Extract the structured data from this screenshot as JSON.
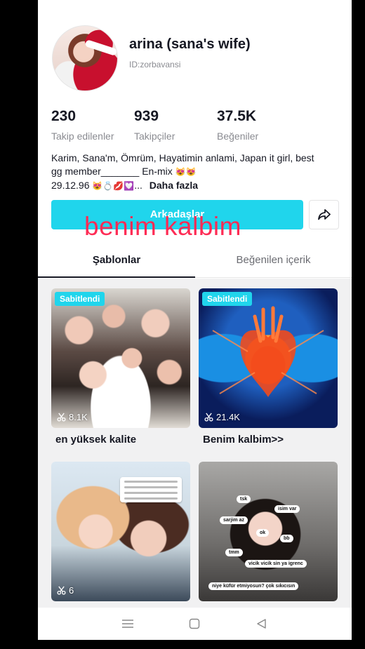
{
  "profile": {
    "username": "arina (sana's wife)",
    "id": "ID:zorbavansi",
    "stats": [
      {
        "value": "230",
        "label": "Takip edilenler"
      },
      {
        "value": "939",
        "label": "Takipçiler"
      },
      {
        "value": "37.5K",
        "label": "Beğeniler"
      }
    ],
    "bio_line1": "Karim, Sana'm, Ömrüm, Hayatimin anlami, Japan it girl, best",
    "bio_line2": "gg member_______ En-mix",
    "bio_line3": "29.12.96",
    "bio_more": "Daha fazla"
  },
  "actions": {
    "friends_label": "Arkadaşlar",
    "overlay_text": "benim kalbim"
  },
  "tabs": [
    {
      "label": "Şablonlar",
      "active": true
    },
    {
      "label": "Beğenilen içerik",
      "active": false
    }
  ],
  "cards": [
    {
      "pinned": "Sabitlendi",
      "uses": "8.1K",
      "title": "en yüksek kalite"
    },
    {
      "pinned": "Sabitlendi",
      "uses": "21.4K",
      "title": "Benim kalbim>>"
    },
    {
      "uses": "6"
    },
    {
      "bubbles": [
        "tsk",
        "isim var",
        "sarjim az",
        "ok",
        "bb",
        "tmm",
        "vicik vicik sin ya igrenc",
        "niye küfür etmiyosun? çok sıkıcısın"
      ]
    }
  ],
  "colors": {
    "accent": "#20d5ec",
    "overlay": "#fe2c55",
    "text": "#161823",
    "muted": "#8a8b91"
  }
}
